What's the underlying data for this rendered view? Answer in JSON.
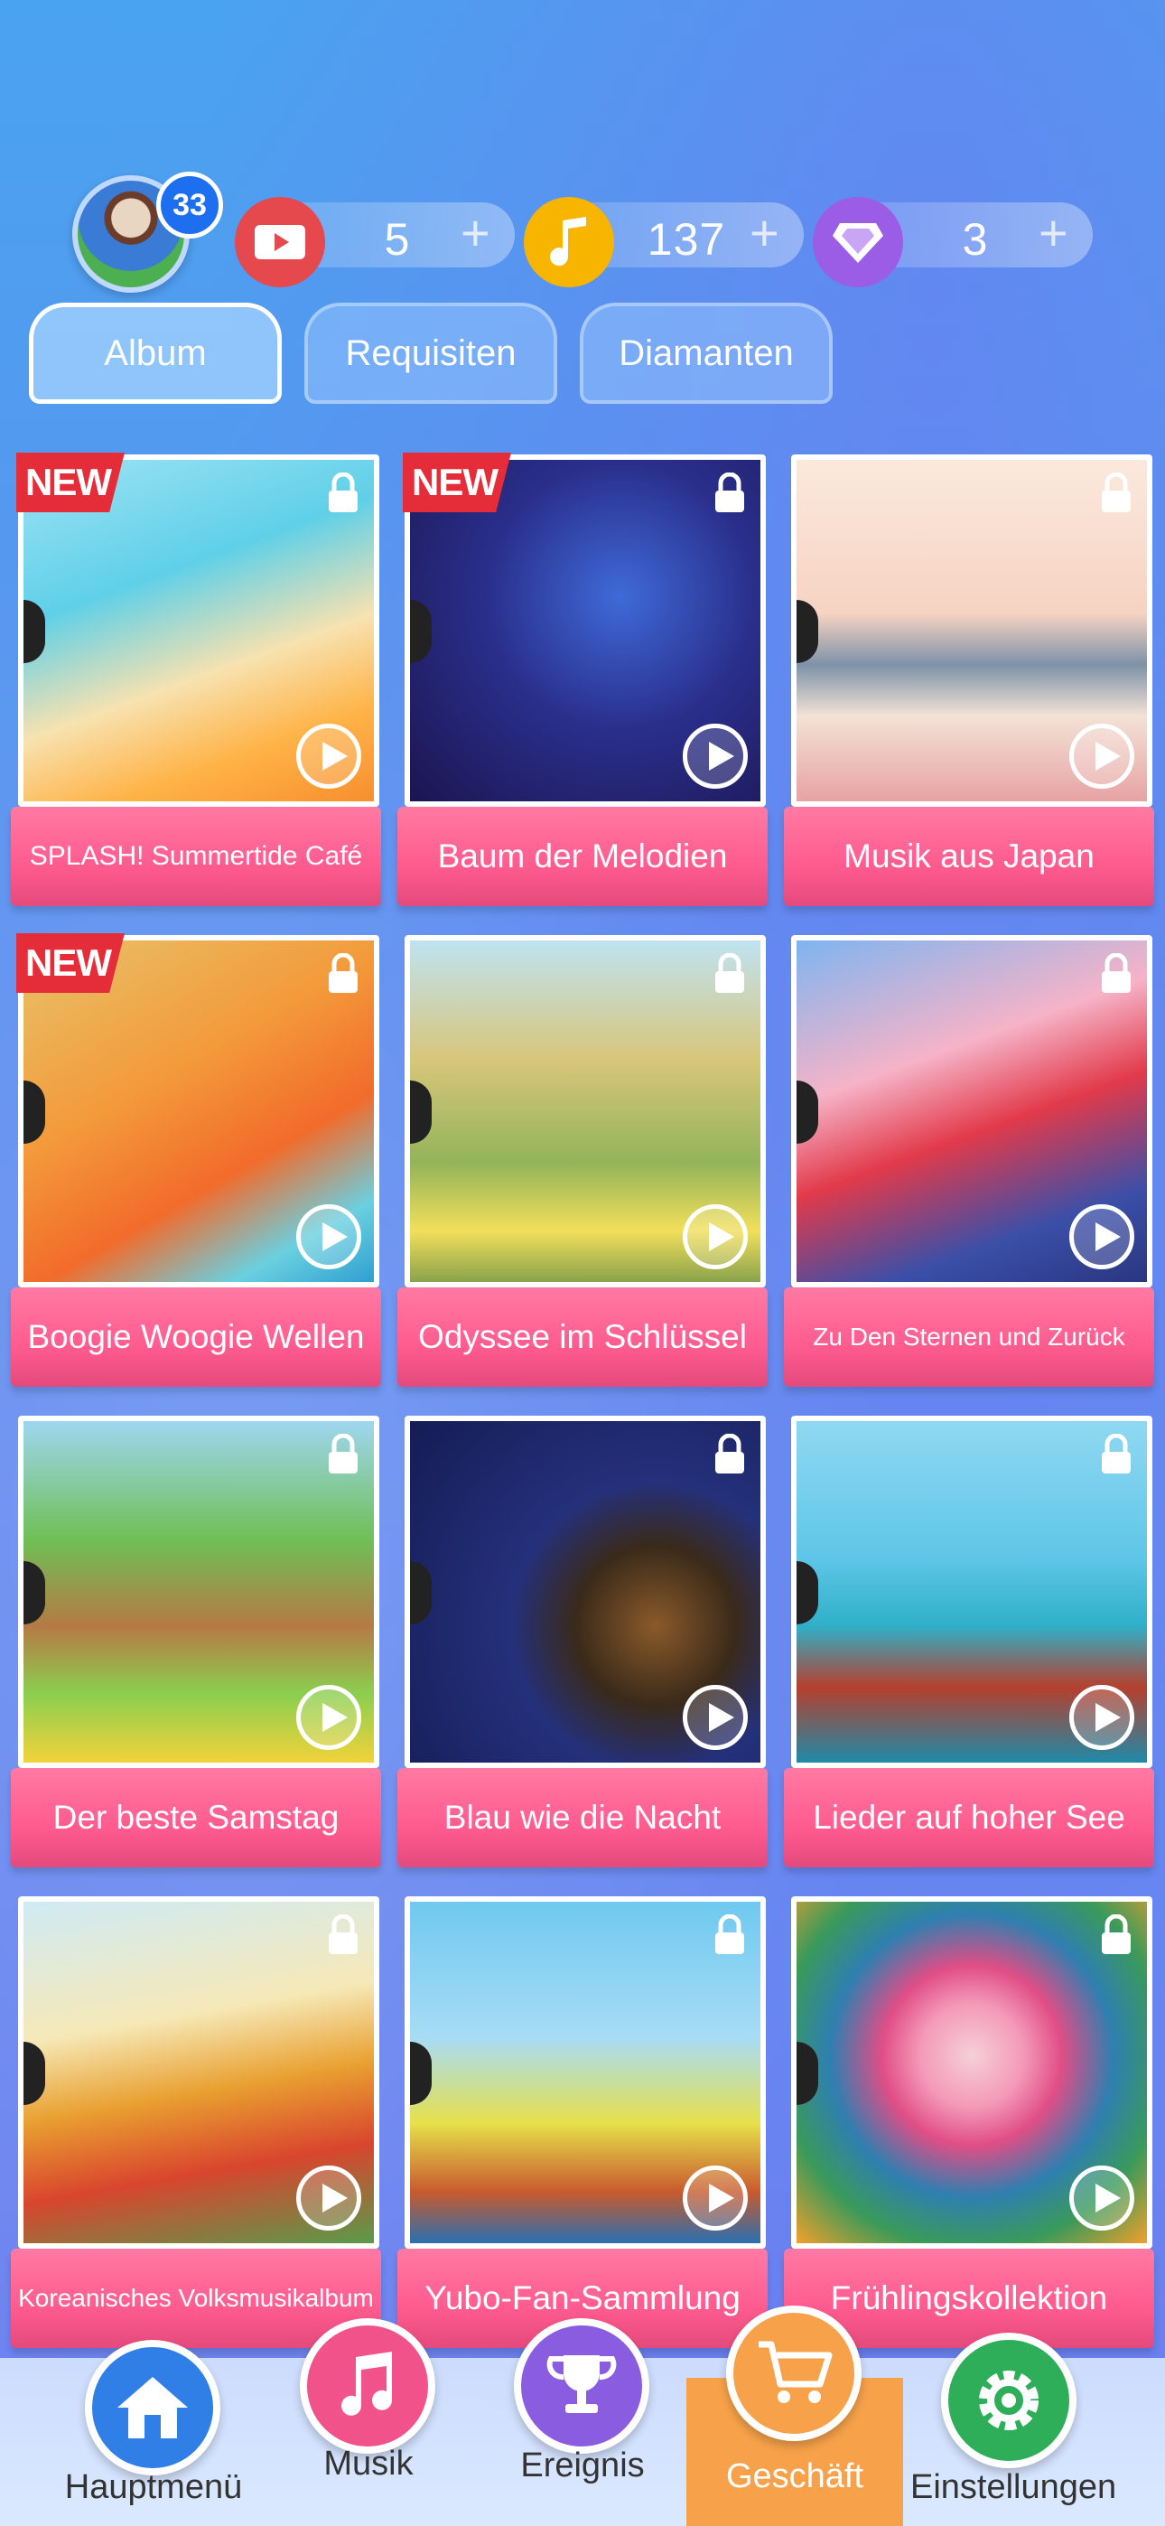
{
  "header": {
    "level": "33",
    "tickets": "5",
    "notes": "137",
    "diamonds": "3",
    "plus": "+"
  },
  "tabs": [
    {
      "label": "Album",
      "active": true
    },
    {
      "label": "Requisiten",
      "active": false
    },
    {
      "label": "Diamanten",
      "active": false
    }
  ],
  "new_badge": "NEW",
  "albums": [
    {
      "title": "SPLASH! Summertide Café",
      "new": true
    },
    {
      "title": "Baum der Melodien",
      "new": true
    },
    {
      "title": "Musik aus Japan",
      "new": false
    },
    {
      "title": "Boogie Woogie Wellen",
      "new": true
    },
    {
      "title": "Odyssee im Schlüssel",
      "new": false
    },
    {
      "title": "Zu Den Sternen und Zurück",
      "new": false
    },
    {
      "title": "Der beste Samstag",
      "new": false
    },
    {
      "title": "Blau wie die Nacht",
      "new": false
    },
    {
      "title": "Lieder auf hoher See",
      "new": false
    },
    {
      "title": "Koreanisches Volksmusikalbum",
      "new": false
    },
    {
      "title": "Yubo-Fan-Sammlung",
      "new": false
    },
    {
      "title": "Frühlingskollektion",
      "new": false
    }
  ],
  "nav": [
    {
      "label": "Hauptmenü",
      "icon": "home-icon",
      "color": "#2f7fe6"
    },
    {
      "label": "Musik",
      "icon": "music-note-icon",
      "color": "#f2528a"
    },
    {
      "label": "Ereignis",
      "icon": "trophy-icon",
      "color": "#8a5de0"
    },
    {
      "label": "Geschäft",
      "icon": "cart-icon",
      "color": "#f7a24a"
    },
    {
      "label": "Einstellungen",
      "icon": "gear-icon",
      "color": "#2fae5a"
    }
  ],
  "colors": {
    "label_pink": "#ff5b8f",
    "new_red": "#e52d3a",
    "active_nav": "#f7a24a"
  }
}
